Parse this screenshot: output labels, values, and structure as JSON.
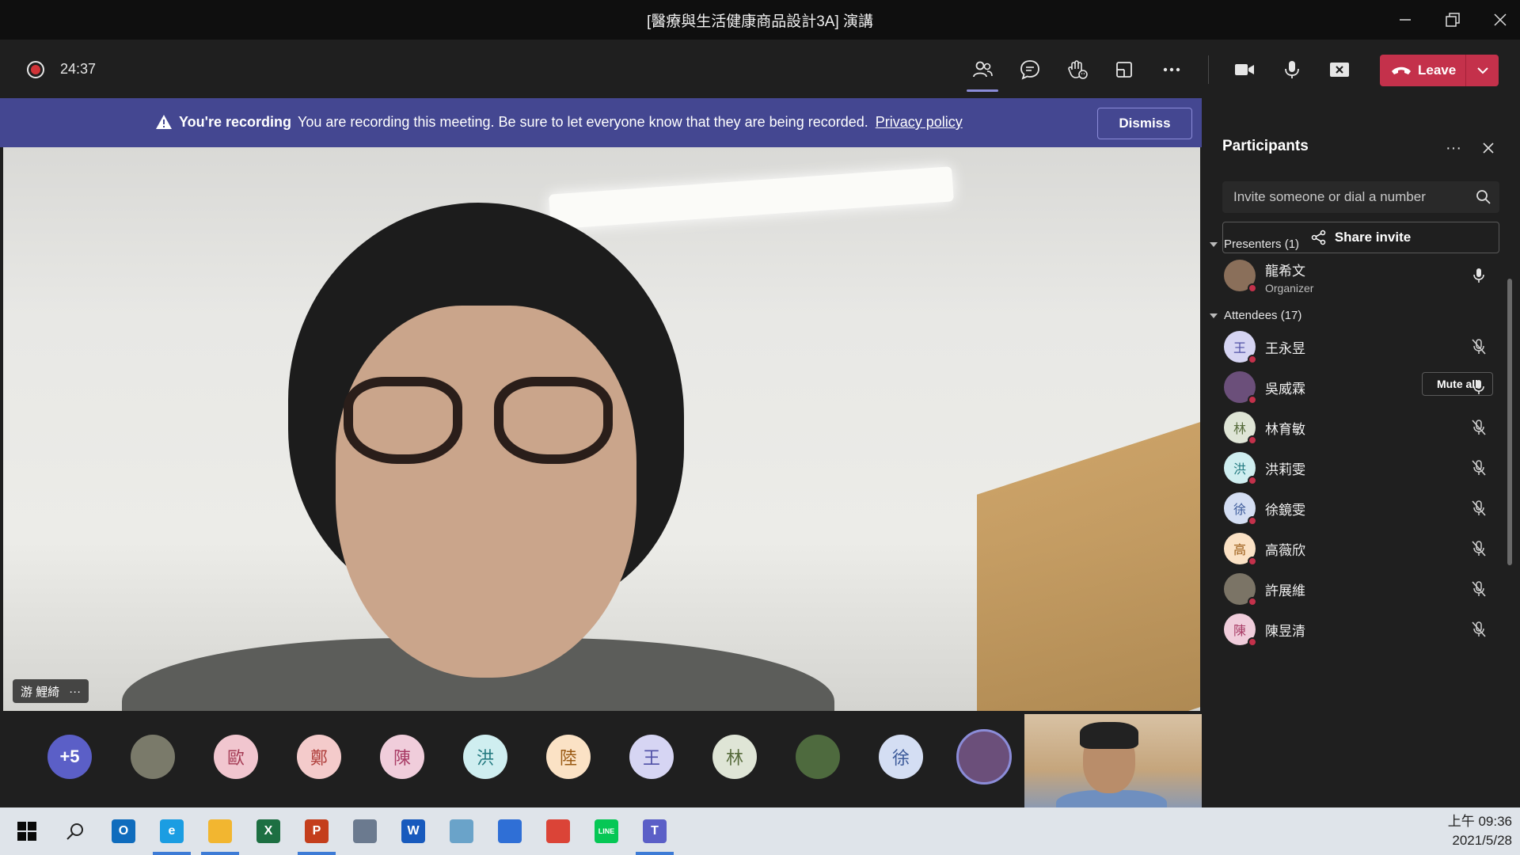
{
  "window": {
    "title": "[醫療與生活健康商品設計3A] 演講"
  },
  "meeting": {
    "timer": "24:37",
    "leave_label": "Leave"
  },
  "banner": {
    "bold": "You're recording",
    "text": "You are recording this meeting. Be sure to let everyone know that they are being recorded.",
    "link": "Privacy policy",
    "dismiss": "Dismiss"
  },
  "video": {
    "speaker_name": "游 鯉綺",
    "more": "···"
  },
  "gallery": [
    {
      "label": "+5",
      "bg": "#5b5fc7",
      "fg": "#ffffff"
    },
    {
      "label": "",
      "bg": "#7a7a6a",
      "fg": "#ffffff"
    },
    {
      "label": "歐",
      "bg": "#f1c6cf",
      "fg": "#a43b54"
    },
    {
      "label": "鄭",
      "bg": "#f4cbcb",
      "fg": "#b0413e"
    },
    {
      "label": "陳",
      "bg": "#f0cddb",
      "fg": "#a83b65"
    },
    {
      "label": "洪",
      "bg": "#cfeef0",
      "fg": "#237a80"
    },
    {
      "label": "陸",
      "bg": "#fbe2c5",
      "fg": "#9a5a14"
    },
    {
      "label": "王",
      "bg": "#d6d5f3",
      "fg": "#4f4fa6"
    },
    {
      "label": "林",
      "bg": "#dfe5d6",
      "fg": "#566b3b"
    },
    {
      "label": "",
      "bg": "#4e6a3e",
      "fg": "#ffffff"
    },
    {
      "label": "徐",
      "bg": "#d4def3",
      "fg": "#3d5b9a"
    },
    {
      "label": "",
      "bg": "#6b4f7a",
      "fg": "#ffffff"
    }
  ],
  "panel": {
    "title": "Participants",
    "invite_placeholder": "Invite someone or dial a number",
    "share_invite": "Share invite",
    "presenters_label": "Presenters (1)",
    "attendees_label": "Attendees (17)",
    "mute_all": "Mute all",
    "presenters": [
      {
        "initial": "",
        "name": "龍希文",
        "role": "Organizer",
        "bg": "#8a6f5a",
        "fg": "#ffffff",
        "mic": "on"
      }
    ],
    "attendees": [
      {
        "initial": "王",
        "name": "王永昱",
        "bg": "#d6d5f3",
        "fg": "#4f4fa6",
        "mic": "off"
      },
      {
        "initial": "",
        "name": "吳威霖",
        "bg": "#6b4f7a",
        "fg": "#ffffff",
        "mic": "on"
      },
      {
        "initial": "林",
        "name": "林育敏",
        "bg": "#dfe5d6",
        "fg": "#566b3b",
        "mic": "off"
      },
      {
        "initial": "洪",
        "name": "洪莉雯",
        "bg": "#cfeef0",
        "fg": "#237a80",
        "mic": "off"
      },
      {
        "initial": "徐",
        "name": "徐鏡雯",
        "bg": "#d4def3",
        "fg": "#3d5b9a",
        "mic": "off"
      },
      {
        "initial": "高",
        "name": "高薇欣",
        "bg": "#fbe2c5",
        "fg": "#9a5a14",
        "mic": "off"
      },
      {
        "initial": "",
        "name": "許展維",
        "bg": "#7b7466",
        "fg": "#ffffff",
        "mic": "off"
      },
      {
        "initial": "陳",
        "name": "陳昱清",
        "bg": "#f0cddb",
        "fg": "#a83b65",
        "mic": "off"
      }
    ]
  },
  "taskbar": {
    "time": "上午 09:36",
    "date": "2021/5/28",
    "apps": [
      {
        "icon": "windows-start-icon",
        "label": "",
        "bg": "#0078d4"
      },
      {
        "icon": "search-icon",
        "label": "",
        "bg": ""
      },
      {
        "icon": "outlook-icon",
        "label": "O",
        "bg": "#0f6cbd"
      },
      {
        "icon": "edge-icon",
        "label": "e",
        "bg": "#1b9de2"
      },
      {
        "icon": "file-explorer-icon",
        "label": "",
        "bg": "#f2b630"
      },
      {
        "icon": "excel-icon",
        "label": "X",
        "bg": "#1d6f42"
      },
      {
        "icon": "powerpoint-icon",
        "label": "P",
        "bg": "#c43e1c"
      },
      {
        "icon": "calculator-icon",
        "label": "",
        "bg": "#6b7a8f"
      },
      {
        "icon": "word-icon",
        "label": "W",
        "bg": "#185abd"
      },
      {
        "icon": "snip-icon",
        "label": "",
        "bg": "#6aa3c9"
      },
      {
        "icon": "media-player-icon",
        "label": "",
        "bg": "#2f6fd6"
      },
      {
        "icon": "chrome-icon",
        "label": "",
        "bg": "#db4437"
      },
      {
        "icon": "line-icon",
        "label": "LINE",
        "bg": "#06c755"
      },
      {
        "icon": "teams-icon",
        "label": "T",
        "bg": "#5b5fc7"
      }
    ]
  }
}
